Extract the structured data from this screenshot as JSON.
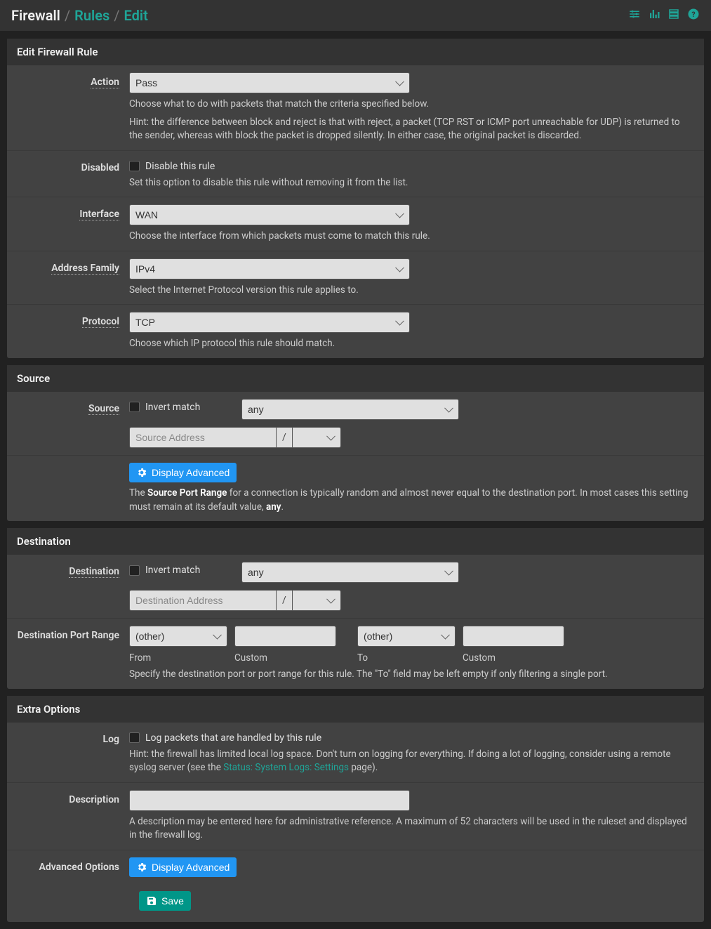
{
  "breadcrumb": {
    "root": "Firewall",
    "l1": "Rules",
    "l2": "Edit"
  },
  "panels": {
    "p1": {
      "title": "Edit Firewall Rule",
      "action": {
        "label": "Action",
        "value": "Pass",
        "help1": "Choose what to do with packets that match the criteria specified below.",
        "help2": "Hint: the difference between block and reject is that with reject, a packet (TCP RST or ICMP port unreachable for UDP) is returned to the sender, whereas with block the packet is dropped silently. In either case, the original packet is discarded."
      },
      "disabled": {
        "label": "Disabled",
        "cb": "Disable this rule",
        "help": "Set this option to disable this rule without removing it from the list."
      },
      "interface": {
        "label": "Interface",
        "value": "WAN",
        "help": "Choose the interface from which packets must come to match this rule."
      },
      "af": {
        "label": "Address Family",
        "value": "IPv4",
        "help": "Select the Internet Protocol version this rule applies to."
      },
      "proto": {
        "label": "Protocol",
        "value": "TCP",
        "help": "Choose which IP protocol this rule should match."
      }
    },
    "p2": {
      "title": "Source",
      "source": {
        "label": "Source",
        "cb": "Invert match",
        "selector": "any",
        "addr_ph": "Source Address",
        "slash": "/"
      },
      "adv": {
        "btn": "Display Advanced",
        "help_pre": "The ",
        "help_b1": "Source Port Range",
        "help_mid": " for a connection is typically random and almost never equal to the destination port. In most cases this setting must remain at its default value, ",
        "help_b2": "any",
        "help_post": "."
      }
    },
    "p3": {
      "title": "Destination",
      "dest": {
        "label": "Destination",
        "cb": "Invert match",
        "selector": "any",
        "addr_ph": "Destination Address",
        "slash": "/"
      },
      "dpr": {
        "label": "Destination Port Range",
        "from_sel": "(other)",
        "from_lbl": "From",
        "from_custom_lbl": "Custom",
        "to_sel": "(other)",
        "to_lbl": "To",
        "to_custom_lbl": "Custom",
        "help": "Specify the destination port or port range for this rule. The \"To\" field may be left empty if only filtering a single port."
      }
    },
    "p4": {
      "title": "Extra Options",
      "log": {
        "label": "Log",
        "cb": "Log packets that are handled by this rule",
        "help_pre": "Hint: the firewall has limited local log space. Don't turn on logging for everything. If doing a lot of logging, consider using a remote syslog server (see the ",
        "help_link": "Status: System Logs: Settings",
        "help_post": " page)."
      },
      "desc": {
        "label": "Description",
        "help": "A description may be entered here for administrative reference. A maximum of 52 characters will be used in the ruleset and displayed in the firewall log."
      },
      "adv": {
        "label": "Advanced Options",
        "btn": "Display Advanced"
      }
    },
    "save": "Save"
  }
}
